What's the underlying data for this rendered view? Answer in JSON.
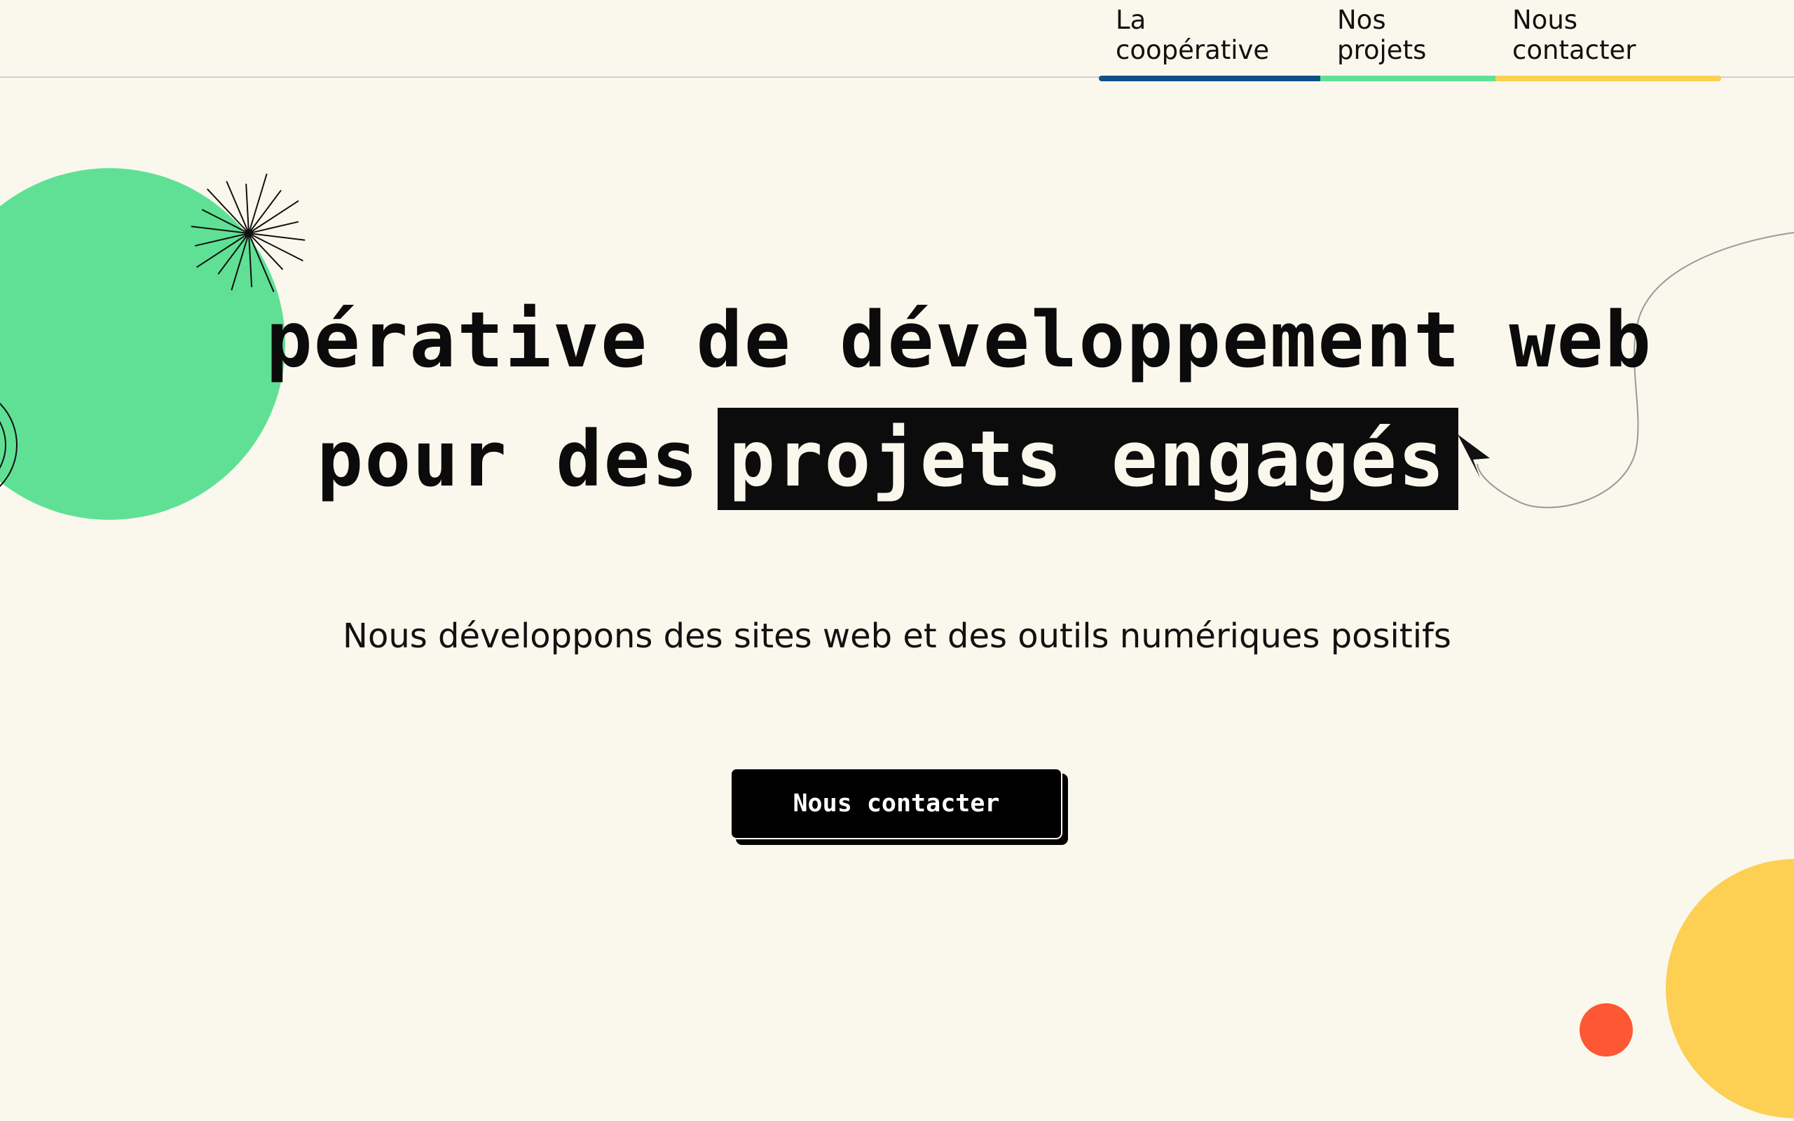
{
  "nav": {
    "items": [
      {
        "label": "La coopérative",
        "color": "#0d4f86"
      },
      {
        "label": "Nos projets",
        "color": "#5fe095"
      },
      {
        "label": "Nous contacter",
        "color": "#fdcf52"
      }
    ]
  },
  "hero": {
    "title_line1": "pérative de développement web",
    "title_line2_prefix": "pour des",
    "title_line2_highlight": "projets engagés",
    "subtitle": "Nous développons des sites web et des outils numériques positifs",
    "cta_label": "Nous contacter"
  },
  "colors": {
    "background": "#faf8ed",
    "green": "#5fe095",
    "yellow": "#fdcf52",
    "red": "#fe5733",
    "ink": "#0b0b0b"
  }
}
